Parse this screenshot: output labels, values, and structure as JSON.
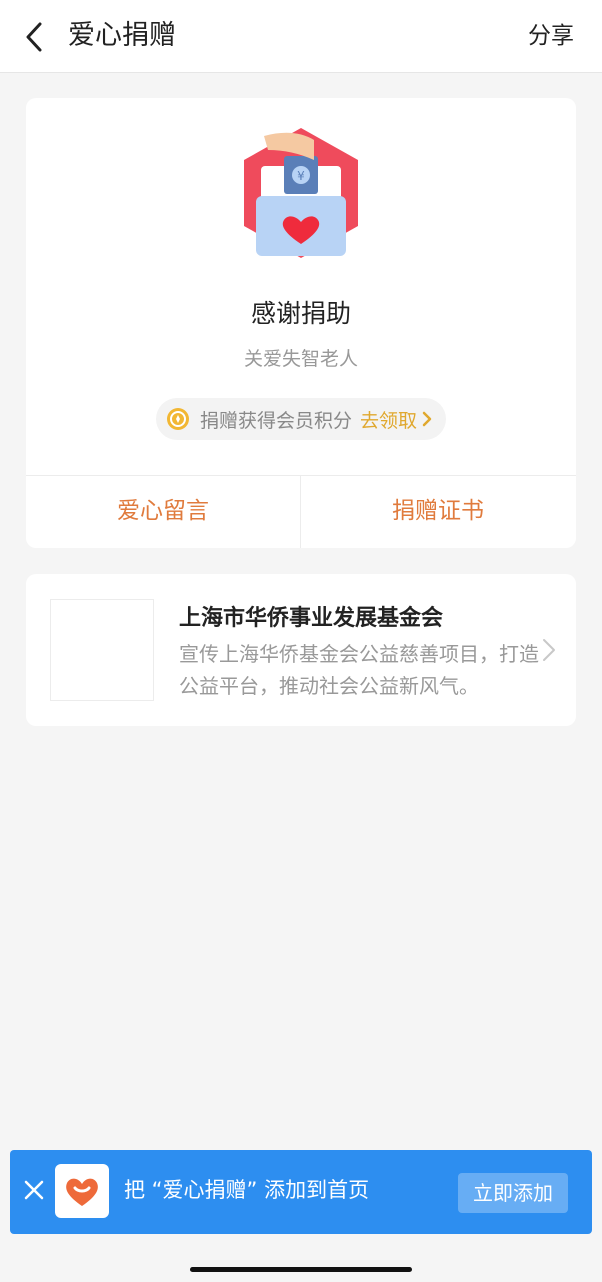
{
  "header": {
    "title": "爱心捐赠",
    "share_label": "分享"
  },
  "donation": {
    "thanks": "感谢捐助",
    "project": "关爱失智老人",
    "points_text": "捐赠获得会员积分",
    "points_link": "去领取",
    "actions": [
      "爱心留言",
      "捐赠证书"
    ]
  },
  "org": {
    "name": "上海市华侨事业发展基金会",
    "desc": "宣传上海华侨基金会公益慈善项目，打造公益平台，推动社会公益新风气。"
  },
  "banner": {
    "text": "把 “爱心捐赠” 添加到首页",
    "button": "立即添加"
  },
  "colors": {
    "accent": "#e07b3d",
    "gold": "#e0a82e",
    "banner": "#2d8ef0"
  },
  "icons": [
    "back-chevron-icon",
    "donation-illustration-icon",
    "medal-icon",
    "arrow-right-icon",
    "close-icon",
    "heart-logo-icon"
  ]
}
